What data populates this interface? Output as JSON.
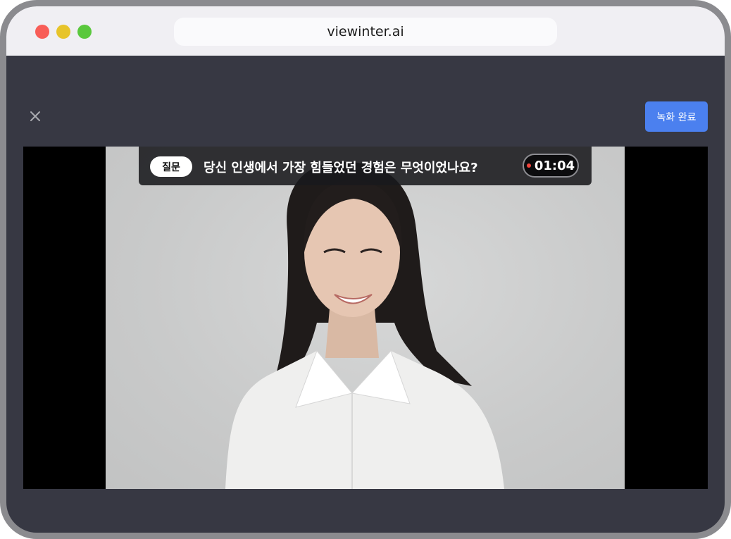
{
  "browser": {
    "url": "viewinter.ai"
  },
  "toolbar": {
    "finish_label": "녹화 완료"
  },
  "question": {
    "badge": "질문",
    "text": "당신 인생에서 가장 힘들었던 경험은 무엇이었나요?",
    "timer": "01:04"
  },
  "colors": {
    "accent": "#4b80ef",
    "recording": "#f2443c"
  }
}
